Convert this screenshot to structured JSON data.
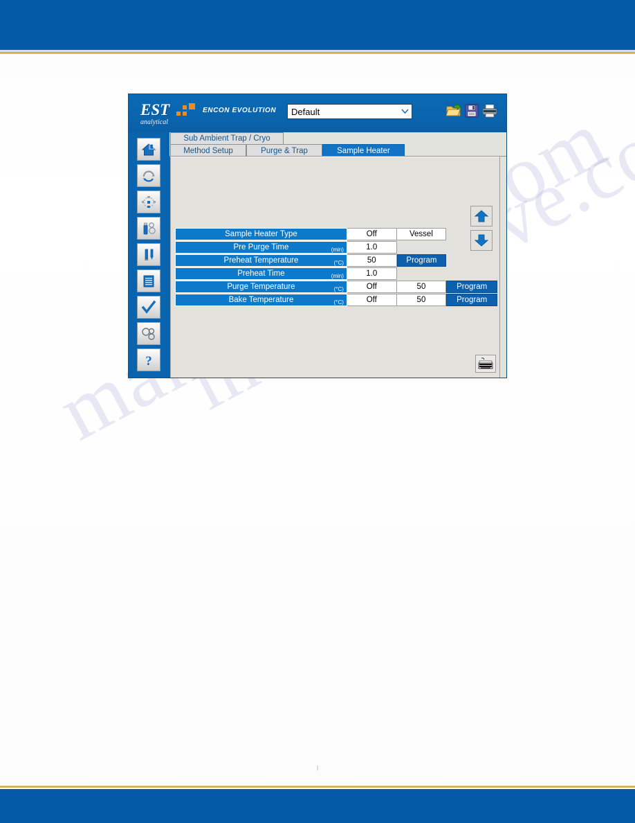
{
  "page": {
    "footer_mark": "|"
  },
  "watermark": {
    "line1": "manualshive.com",
    "line2": "manualshive.com"
  },
  "app": {
    "logo": {
      "primary": "EST",
      "secondary": "analytical",
      "product": "ENCON EVOLUTION"
    },
    "method_select": {
      "value": "Default",
      "icon": "chevron-down-icon"
    },
    "toolbar": [
      {
        "name": "open-folder-icon",
        "label": "Open"
      },
      {
        "name": "save-floppy-icon",
        "label": "Save"
      },
      {
        "name": "printer-icon",
        "label": "Print"
      }
    ],
    "sidebar": [
      {
        "name": "home-icon",
        "label": "Home"
      },
      {
        "name": "cycle-refresh-icon",
        "label": "Cycle"
      },
      {
        "name": "flow-diagram-icon",
        "label": "Flow Diagram"
      },
      {
        "name": "vial-sample-icon",
        "label": "Sample"
      },
      {
        "name": "tools-icon",
        "label": "Tools"
      },
      {
        "name": "method-list-icon",
        "label": "Method"
      },
      {
        "name": "checkmark-icon",
        "label": "Check"
      },
      {
        "name": "rings-icon",
        "label": "Diagnostics"
      },
      {
        "name": "question-mark-icon",
        "label": "Help"
      }
    ],
    "tabs": {
      "top": {
        "label": "Sub Ambient Trap / Cryo",
        "active": false
      },
      "bottom": [
        {
          "label": "Method Setup",
          "active": false
        },
        {
          "label": "Purge & Trap",
          "active": false
        },
        {
          "label": "Sample Heater",
          "active": true
        }
      ]
    },
    "nav": {
      "up": "up-arrow-icon",
      "down": "down-arrow-icon"
    },
    "keyboard_button": {
      "icon": "keyboard-icon"
    },
    "settings_rows": [
      {
        "label": "Sample Heater Type",
        "unit": "",
        "value": "Off",
        "value2": "Vessel",
        "value2_kind": "field",
        "button": ""
      },
      {
        "label": "Pre Purge Time",
        "unit": "(min)",
        "value": "1.0",
        "value2": "",
        "value2_kind": "blank",
        "button": ""
      },
      {
        "label": "Preheat Temperature",
        "unit": "(°C)",
        "value": "50",
        "value2": "Program",
        "value2_kind": "button",
        "button": ""
      },
      {
        "label": "Preheat Time",
        "unit": "(min)",
        "value": "1.0",
        "value2": "",
        "value2_kind": "blank",
        "button": ""
      },
      {
        "label": "Purge Temperature",
        "unit": "(°C)",
        "value": "Off",
        "value2": "50",
        "value2_kind": "field",
        "button": "Program"
      },
      {
        "label": "Bake Temperature",
        "unit": "(°C)",
        "value": "Off",
        "value2": "50",
        "value2_kind": "field",
        "button": "Program"
      }
    ]
  },
  "colors": {
    "brand_blue": "#0459a6",
    "app_blue": "#0a64ad",
    "row_blue": "#0d79cb",
    "button_blue": "#0d60ad",
    "accent_orange": "#f08a1c",
    "gold_rule": "#c8982f",
    "panel_gray": "#e3e1dc"
  }
}
